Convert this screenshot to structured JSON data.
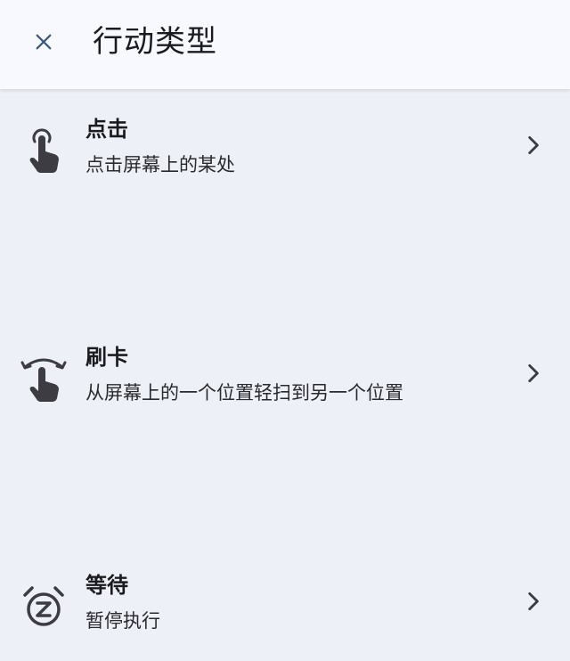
{
  "header": {
    "title": "行动类型",
    "close_icon": "close-icon"
  },
  "actions": [
    {
      "label": "点击",
      "description": "点击屏幕上的某处",
      "icon": "tap-icon"
    },
    {
      "label": "刷卡",
      "description": "从屏幕上的一个位置轻扫到另一个位置",
      "icon": "swipe-icon"
    },
    {
      "label": "等待",
      "description": "暂停执行",
      "icon": "wait-clock-icon"
    }
  ],
  "colors": {
    "background": "#eef0f7",
    "header_background": "#f8f9ff",
    "icon": "#3c3c42",
    "close_icon": "#3b5a7a"
  }
}
